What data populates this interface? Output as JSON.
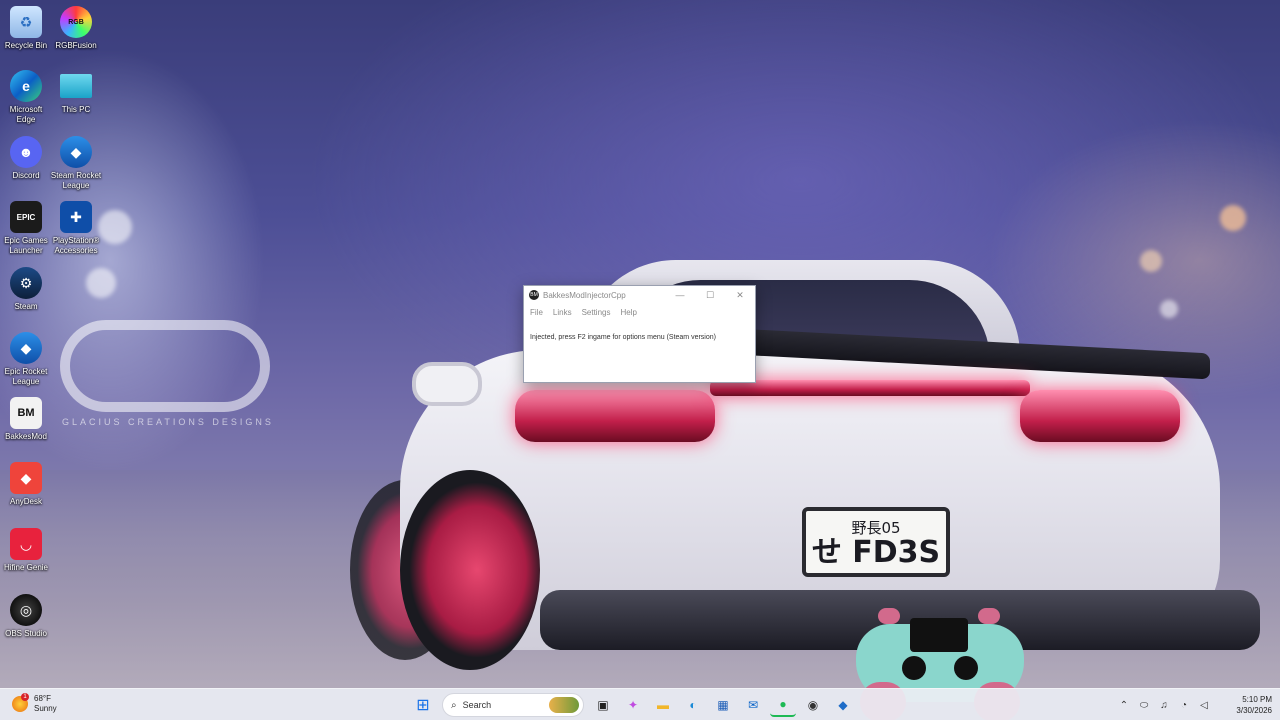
{
  "wallpaper": {
    "logo_tagline": "GLACIUS CREATIONS DESIGNS",
    "plate_line1": "野長05",
    "plate_line2": "せ FD3S"
  },
  "desktop_icons": [
    {
      "label": "Recycle Bin",
      "icon": "recycle-bin-icon"
    },
    {
      "label": "RGBFusion",
      "icon": "rgb-fusion-icon"
    },
    {
      "label": "Microsoft Edge",
      "icon": "edge-icon"
    },
    {
      "label": "This PC",
      "icon": "this-pc-icon"
    },
    {
      "label": "Discord",
      "icon": "discord-icon"
    },
    {
      "label": "Steam Rocket League",
      "icon": "rocket-league-icon"
    },
    {
      "label": "Epic Games Launcher",
      "icon": "epic-games-icon"
    },
    {
      "label": "PlayStation® Accessories",
      "icon": "playstation-icon"
    },
    {
      "label": "Steam",
      "icon": "steam-icon"
    },
    {
      "label": "Epic Rocket League",
      "icon": "rocket-league-icon"
    },
    {
      "label": "BakkesMod",
      "icon": "bakkesmod-icon"
    },
    {
      "label": "AnyDesk",
      "icon": "anydesk-icon"
    },
    {
      "label": "Hifine Genie",
      "icon": "hifine-genie-icon"
    },
    {
      "label": "OBS Studio",
      "icon": "obs-icon"
    }
  ],
  "window": {
    "title": "BakkesModInjectorCpp",
    "app_icon_text": "BM",
    "controls": {
      "minimize": "—",
      "maximize": "☐",
      "close": "✕"
    },
    "menu": [
      "File",
      "Links",
      "Settings",
      "Help"
    ],
    "message": "Injected, press F2 ingame for options menu (Steam version)"
  },
  "taskbar": {
    "weather": {
      "temp": "68°F",
      "condition": "Sunny",
      "badge": "1"
    },
    "search_placeholder": "Search",
    "apps": [
      {
        "name": "start",
        "glyph": "⊞",
        "color": "#1a73e8"
      },
      {
        "name": "task-view",
        "glyph": "▣",
        "color": "#222"
      },
      {
        "name": "copilot",
        "glyph": "✦",
        "color": "#c04be0"
      },
      {
        "name": "file-explorer",
        "glyph": "▬",
        "color": "#f1b62a"
      },
      {
        "name": "edge",
        "glyph": "◐",
        "color": "#1b8ad6"
      },
      {
        "name": "store",
        "glyph": "▦",
        "color": "#1f5fb8"
      },
      {
        "name": "outlook",
        "glyph": "✉",
        "color": "#0a64c8"
      },
      {
        "name": "spotify",
        "glyph": "●",
        "color": "#1db954"
      },
      {
        "name": "bakkesmod",
        "glyph": "◉",
        "color": "#333"
      },
      {
        "name": "rocket-league",
        "glyph": "◆",
        "color": "#1e6cc8"
      }
    ],
    "tray": {
      "chevron": "⌃",
      "network": "⬭",
      "mic": "♫",
      "wifi": "◔",
      "volume": "◁"
    },
    "clock": {
      "time": "5:10 PM",
      "date": "3/30/2026"
    }
  }
}
